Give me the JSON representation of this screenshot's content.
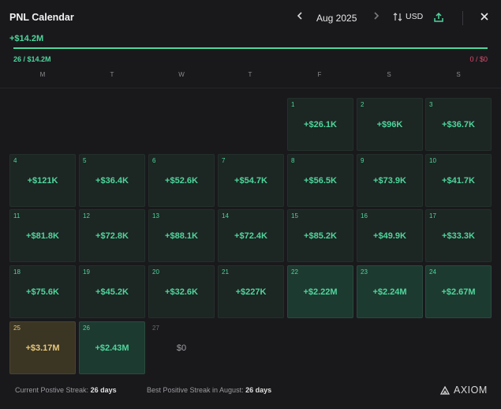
{
  "header": {
    "title": "PNL Calendar",
    "prev_label": "‹",
    "month": "Aug 2025",
    "next_label": "›",
    "currency": "USD",
    "close_label": "✕"
  },
  "summary": {
    "total": "+$14.2M",
    "positive": "26 / $14.2M",
    "negative": "0 / $0",
    "progress_fraction": 1.0
  },
  "weekdays": [
    "M",
    "T",
    "W",
    "T",
    "F",
    "S",
    "S"
  ],
  "days": [
    {
      "day": "1",
      "pnl": "+$26.1K",
      "style": "normal"
    },
    {
      "day": "2",
      "pnl": "+$96K",
      "style": "normal"
    },
    {
      "day": "3",
      "pnl": "+$36.7K",
      "style": "normal"
    },
    {
      "day": "4",
      "pnl": "+$121K",
      "style": "normal"
    },
    {
      "day": "5",
      "pnl": "+$36.4K",
      "style": "normal"
    },
    {
      "day": "6",
      "pnl": "+$52.6K",
      "style": "normal"
    },
    {
      "day": "7",
      "pnl": "+$54.7K",
      "style": "normal"
    },
    {
      "day": "8",
      "pnl": "+$56.5K",
      "style": "normal"
    },
    {
      "day": "9",
      "pnl": "+$73.9K",
      "style": "normal"
    },
    {
      "day": "10",
      "pnl": "+$41.7K",
      "style": "normal"
    },
    {
      "day": "11",
      "pnl": "+$81.8K",
      "style": "normal"
    },
    {
      "day": "12",
      "pnl": "+$72.8K",
      "style": "normal"
    },
    {
      "day": "13",
      "pnl": "+$88.1K",
      "style": "normal"
    },
    {
      "day": "14",
      "pnl": "+$72.4K",
      "style": "normal"
    },
    {
      "day": "15",
      "pnl": "+$85.2K",
      "style": "normal"
    },
    {
      "day": "16",
      "pnl": "+$49.9K",
      "style": "normal"
    },
    {
      "day": "17",
      "pnl": "+$33.3K",
      "style": "normal"
    },
    {
      "day": "18",
      "pnl": "+$75.6K",
      "style": "normal"
    },
    {
      "day": "19",
      "pnl": "+$45.2K",
      "style": "normal"
    },
    {
      "day": "20",
      "pnl": "+$32.6K",
      "style": "normal"
    },
    {
      "day": "21",
      "pnl": "+$227K",
      "style": "normal"
    },
    {
      "day": "22",
      "pnl": "+$2.22M",
      "style": "strong"
    },
    {
      "day": "23",
      "pnl": "+$2.24M",
      "style": "strong"
    },
    {
      "day": "24",
      "pnl": "+$2.67M",
      "style": "strong"
    },
    {
      "day": "25",
      "pnl": "+$3.17M",
      "style": "gold"
    },
    {
      "day": "26",
      "pnl": "+$2.43M",
      "style": "strong"
    },
    {
      "day": "27",
      "pnl": "$0",
      "style": "empty"
    }
  ],
  "footer": {
    "current_label": "Current Postive Streak:",
    "current_value": "26 days",
    "best_label": "Best Positive Streak in August:",
    "best_value": "26 days",
    "brand": "AXIOM"
  },
  "colors": {
    "positive": "#4fd69c",
    "negative": "#e04a6a",
    "gold": "#e8c879",
    "background": "#19191c"
  },
  "icons": [
    "chevron-left-icon",
    "chevron-right-icon",
    "sort-arrows-icon",
    "share-icon",
    "close-icon",
    "axiom-logo-icon"
  ]
}
